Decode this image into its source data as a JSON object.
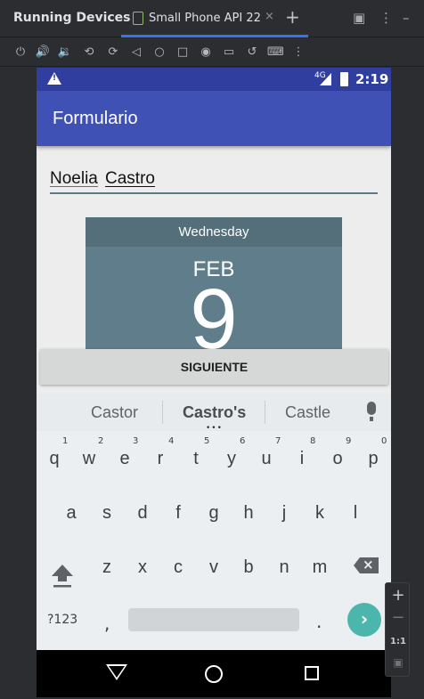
{
  "ide": {
    "panel_title": "Running Devices",
    "device_tab": "Small Phone API 22",
    "tab_close": "×",
    "add_tab": "+",
    "toolbar_icons": [
      "power-icon",
      "volume-up-icon",
      "volume-down-icon",
      "rotate-left-icon",
      "rotate-right-icon",
      "back-icon",
      "home-icon",
      "overview-icon",
      "screenshot-icon",
      "screen-record-icon",
      "undo-icon",
      "keyboard-icon",
      "more-icon"
    ]
  },
  "status_bar": {
    "network": "4G",
    "time": "2:19"
  },
  "app": {
    "title": "Formulario"
  },
  "form": {
    "name_first": "Noelia",
    "name_last": "Castro"
  },
  "date_picker": {
    "day_of_week": "Wednesday",
    "month": "FEB",
    "day": "9"
  },
  "next_button": "SIGUIENTE",
  "keyboard": {
    "suggestions": [
      "Castor",
      "Castro's",
      "Castle"
    ],
    "row1": [
      "q",
      "w",
      "e",
      "r",
      "t",
      "y",
      "u",
      "i",
      "o",
      "p"
    ],
    "row1_hints": [
      "1",
      "2",
      "3",
      "4",
      "5",
      "6",
      "7",
      "8",
      "9",
      "0"
    ],
    "row2": [
      "a",
      "s",
      "d",
      "f",
      "g",
      "h",
      "j",
      "k",
      "l"
    ],
    "row3": [
      "z",
      "x",
      "c",
      "v",
      "b",
      "n",
      "m"
    ],
    "symbols_label": "?123",
    "comma": ",",
    "period": ".",
    "enter": "›"
  },
  "zoom_panel": {
    "zoom_in": "+",
    "zoom_out": "−",
    "actual_size": "1:1"
  }
}
